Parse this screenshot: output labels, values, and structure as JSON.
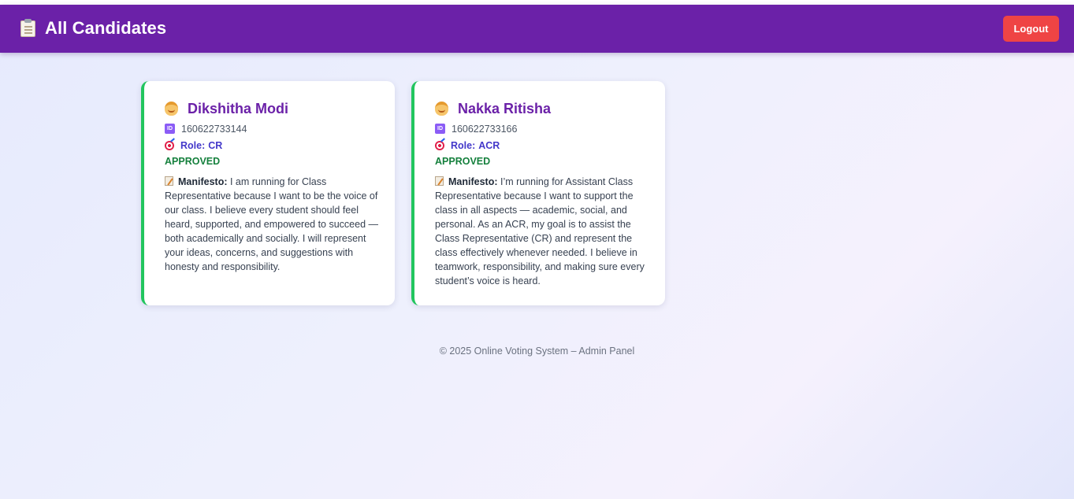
{
  "header": {
    "title": "All Candidates",
    "icon": "clipboard-icon",
    "logout_label": "Logout",
    "color": "#6b21a8"
  },
  "candidates": [
    {
      "name": "Dikshitha Modi",
      "id": "160622733144",
      "role_label": "Role:",
      "role": "CR",
      "status": "APPROVED",
      "manifesto_label": "Manifesto:",
      "manifesto": "I am running for Class Representative because I want to be the voice of our class. I believe every student should feel heard, supported, and empowered to succeed — both academically and socially. I will represent your ideas, concerns, and suggestions with honesty and responsibility."
    },
    {
      "name": "Nakka Ritisha",
      "id": "160622733166",
      "role_label": "Role:",
      "role": "ACR",
      "status": "APPROVED",
      "manifesto_label": "Manifesto:",
      "manifesto": "I’m running for Assistant Class Representative because I want to support the class in all aspects — academic, social, and personal. As an ACR, my goal is to assist the Class Representative (CR) and represent the class effectively whenever needed. I believe in teamwork, responsibility, and making sure every student’s voice is heard."
    }
  ],
  "footer": {
    "text": "© 2025 Online Voting System – Admin Panel"
  },
  "colors": {
    "accent": "#6b21a8",
    "logout": "#ef4444",
    "approved": "#15803d",
    "card_border": "#22c55e",
    "role": "#4338ca"
  }
}
